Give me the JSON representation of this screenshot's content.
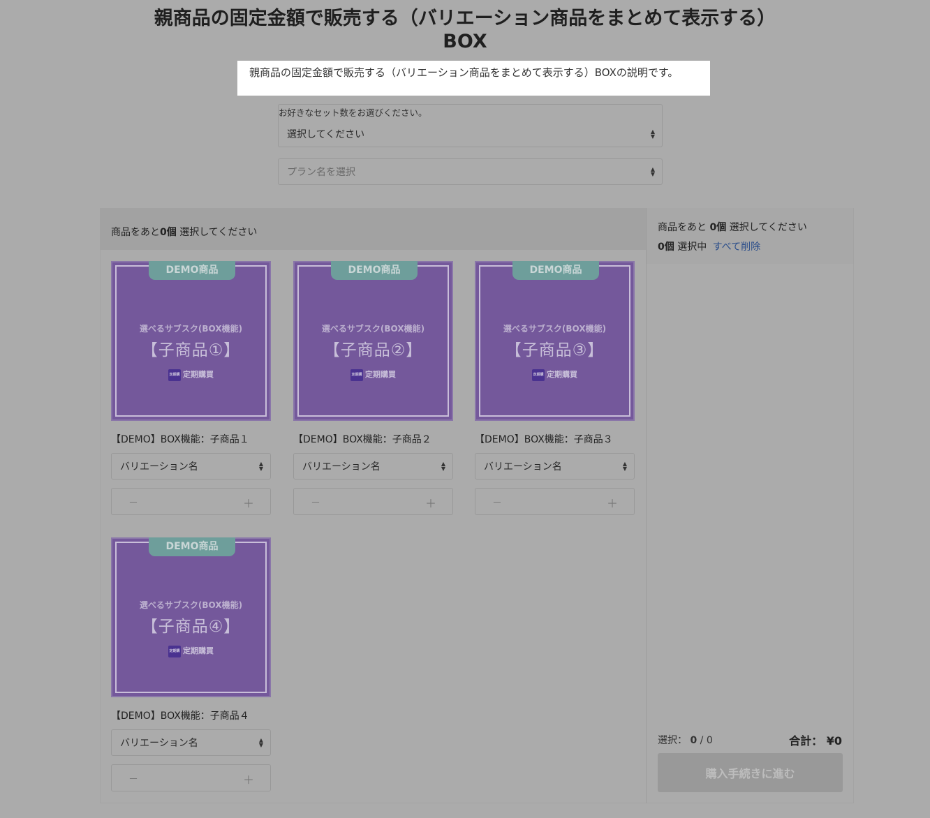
{
  "box": {
    "title_line1": "親商品の固定金額で販売する（バリエーション商品をまとめて表示する）",
    "title_line2": "BOX",
    "description": "親商品の固定金額で販売する（バリエーション商品をまとめて表示する）BOXの説明です。",
    "set_label": "お好きなセット数をお選びください。",
    "set_select_value": "選択してください",
    "plan_select_placeholder": "プラン名を選択"
  },
  "left_header": {
    "prefix": "商品をあと",
    "count": "0個",
    "suffix": " 選択してください"
  },
  "right_header": {
    "prefix": "商品をあと ",
    "count": "0個",
    "suffix": " 選択してください",
    "selected_count": "0個",
    "selected_suffix": " 選択中",
    "clear_all": "すべて削除"
  },
  "products": [
    {
      "badge": "DEMO商品",
      "sub": "選べるサブスク(BOX機能)",
      "main": "【子商品①】",
      "tag": "定期購買",
      "tag_icon": "定期購買",
      "name": "【DEMO】BOX機能：子商品１",
      "variation": "バリエーション名",
      "minus": "－",
      "plus": "＋"
    },
    {
      "badge": "DEMO商品",
      "sub": "選べるサブスク(BOX機能)",
      "main": "【子商品②】",
      "tag": "定期購買",
      "tag_icon": "定期購買",
      "name": "【DEMO】BOX機能：子商品２",
      "variation": "バリエーション名",
      "minus": "－",
      "plus": "＋"
    },
    {
      "badge": "DEMO商品",
      "sub": "選べるサブスク(BOX機能)",
      "main": "【子商品③】",
      "tag": "定期購買",
      "tag_icon": "定期購買",
      "name": "【DEMO】BOX機能：子商品３",
      "variation": "バリエーション名",
      "minus": "－",
      "plus": "＋"
    },
    {
      "badge": "DEMO商品",
      "sub": "選べるサブスク(BOX機能)",
      "main": "【子商品④】",
      "tag": "定期購買",
      "tag_icon": "定期購買",
      "name": "【DEMO】BOX機能：子商品４",
      "variation": "バリエーション名",
      "minus": "－",
      "plus": "＋"
    }
  ],
  "footer": {
    "selected_label": "選択：",
    "selected_value": "0",
    "selected_max": "/ 0",
    "total_label": "合計：",
    "total_value": "¥0",
    "checkout_label": "購入手続きに進む"
  },
  "icons": {
    "select_arrows": "sort-arrows-icon",
    "minus": "minus-icon",
    "plus": "plus-icon"
  },
  "colors": {
    "overlay": "#ababab",
    "product_purple": "#74589b",
    "badge_teal": "#6e9e9b",
    "link": "#2a4d8a"
  }
}
